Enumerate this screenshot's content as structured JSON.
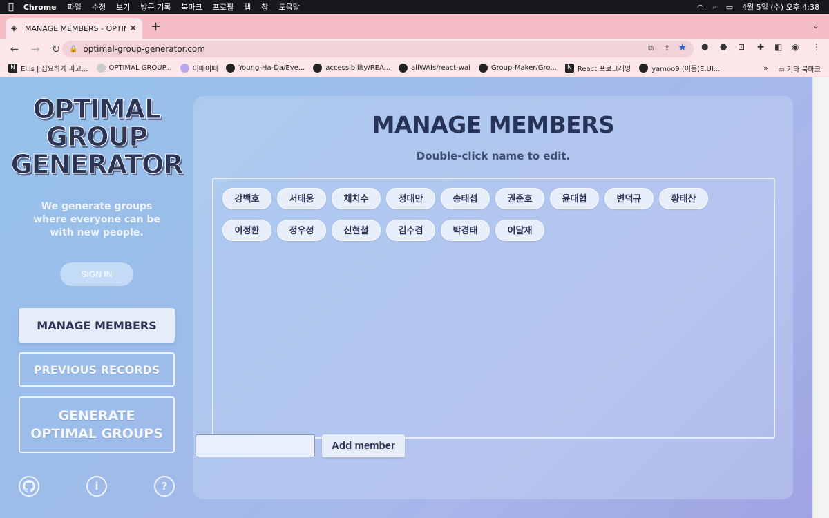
{
  "macbar": {
    "app": "Chrome",
    "menus": [
      "파일",
      "수정",
      "보기",
      "방문 기록",
      "북마크",
      "프로필",
      "탭",
      "창",
      "도움말"
    ],
    "datetime": "4월 5일 (수) 오후 4:38"
  },
  "browser": {
    "tab_title": "MANAGE MEMBERS - OPTIMAL",
    "url": "optimal-group-generator.com",
    "bookmarks": [
      "Ellis | 집요하게 파고...",
      "OPTIMAL GROUP...",
      "이때어때",
      "Young-Ha-Da/Eve...",
      "accessibility/REA...",
      "allWAIs/react-wai",
      "Group-Maker/Gro...",
      "React 프로그래밍",
      "yamoo9 (이듬(E.UI..."
    ],
    "bookmarks_more": "»",
    "bookmarks_folder": "기타 북마크"
  },
  "sidebar": {
    "logo_lines": [
      "OPTIMAL",
      "GROUP",
      "GENERATOR"
    ],
    "tagline_lines": [
      "We generate groups",
      "where everyone can be",
      "with new people."
    ],
    "sign_in": "SIGN IN",
    "manage_members": "MANAGE MEMBERS",
    "previous_records": "PREVIOUS RECORDS",
    "generate_lines": [
      "GENERATE",
      "OPTIMAL GROUPS"
    ],
    "icons": [
      "github-icon",
      "info-icon",
      "help-icon"
    ]
  },
  "main": {
    "title": "MANAGE MEMBERS",
    "subtitle": "Double-click name to edit.",
    "members": [
      "강백호",
      "서태웅",
      "채치수",
      "정대만",
      "송태섭",
      "권준호",
      "윤대협",
      "변덕규",
      "황태산",
      "이정환",
      "정우성",
      "신현철",
      "김수겸",
      "박경태",
      "이달재"
    ],
    "input_value": "",
    "add_button": "Add member"
  }
}
